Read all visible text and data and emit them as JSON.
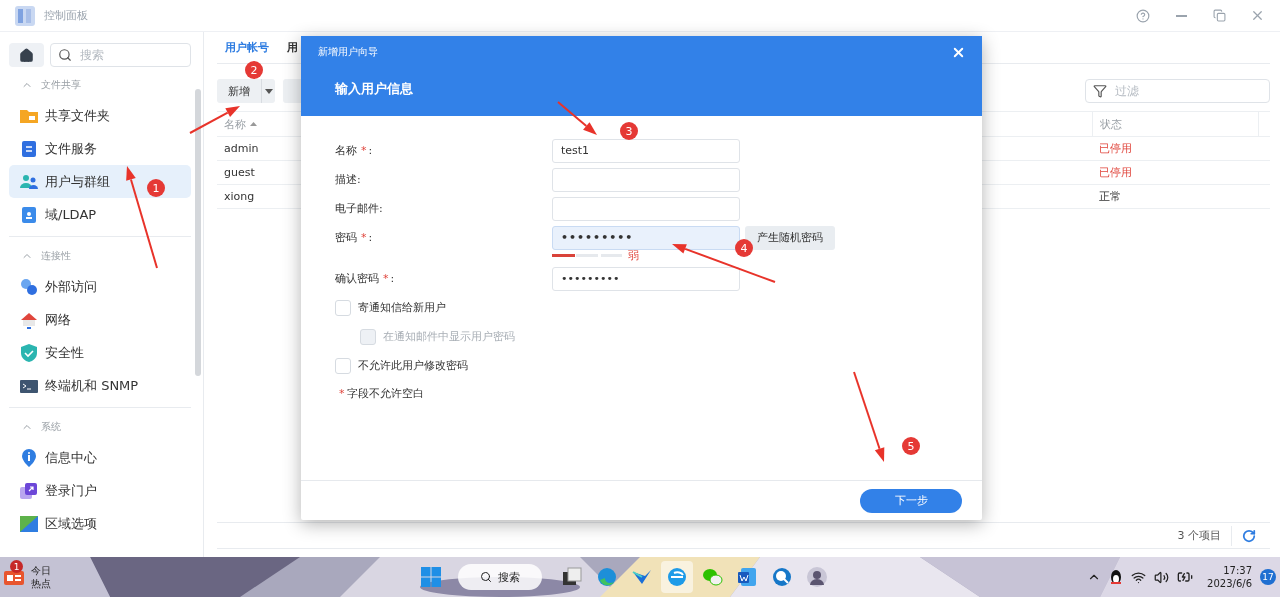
{
  "window": {
    "title": "控制面板"
  },
  "sidebar": {
    "search": {
      "placeholder": "搜索"
    },
    "sections": [
      {
        "title": "文件共享",
        "expanded": true,
        "items": [
          {
            "kind": "folder",
            "label": "共享文件夹",
            "selected": false
          },
          {
            "kind": "file-service",
            "label": "文件服务",
            "selected": false
          },
          {
            "kind": "users",
            "label": "用户与群组",
            "selected": true
          },
          {
            "kind": "ldap",
            "label": "域/LDAP",
            "selected": false
          }
        ]
      },
      {
        "title": "连接性",
        "expanded": true,
        "items": [
          {
            "kind": "external",
            "label": "外部访问",
            "selected": false
          },
          {
            "kind": "network",
            "label": "网络",
            "selected": false
          },
          {
            "kind": "security",
            "label": "安全性",
            "selected": false
          },
          {
            "kind": "terminal",
            "label": "终端机和 SNMP",
            "selected": false
          }
        ]
      },
      {
        "title": "系统",
        "expanded": true,
        "items": [
          {
            "kind": "info",
            "label": "信息中心",
            "selected": false
          },
          {
            "kind": "portal",
            "label": "登录门户",
            "selected": false
          },
          {
            "kind": "region",
            "label": "区域选项",
            "selected": false
          }
        ]
      }
    ]
  },
  "tabs": [
    {
      "label": "用户帐号",
      "selected": true
    },
    {
      "label": "用",
      "selected": false
    }
  ],
  "toolbar": {
    "create_button": "新增",
    "filter": {
      "placeholder": "过滤"
    }
  },
  "table": {
    "columns": [
      "名称",
      "状态"
    ],
    "rows": [
      {
        "name": "admin",
        "status": "已停用",
        "warning": true
      },
      {
        "name": "guest",
        "status": "已停用",
        "warning": true
      },
      {
        "name": "xiong",
        "status": "正常",
        "warning": false
      }
    ]
  },
  "footer": {
    "count": "3 个项目"
  },
  "dialog": {
    "title": "新增用户向导",
    "heading": "输入用户信息",
    "fields": [
      {
        "kind": "text",
        "label": "名称",
        "mark": "*",
        "colon": ":",
        "value": "test1",
        "focused": false
      },
      {
        "kind": "text",
        "label": "描述:",
        "focused": false
      },
      {
        "kind": "text",
        "label": "电子邮件:",
        "focused": false
      },
      {
        "kind": "password",
        "label": "密码",
        "mark": "*",
        "colon": ":",
        "value": "•••••••••",
        "focused": true,
        "button": "产生随机密码",
        "strength": {
          "level": 0.33,
          "label": "弱"
        }
      },
      {
        "kind": "text",
        "label": "确认密码",
        "mark": "*",
        "colon": ":",
        "value": "•••••••••",
        "focused": false
      }
    ],
    "checkboxes": [
      {
        "label": "寄通知信给新用户",
        "checked": false,
        "disabled": false,
        "children": [
          {
            "label": "在通知邮件中显示用户密码",
            "checked": false,
            "disabled": true
          }
        ]
      },
      {
        "label": "不允许此用户修改密码",
        "checked": false,
        "disabled": false
      }
    ],
    "note": {
      "mark": "*",
      "text": "字段不允许空白"
    },
    "next_button": "下一步"
  },
  "annotations": [
    {
      "number": "1"
    },
    {
      "number": "2"
    },
    {
      "number": "3"
    },
    {
      "number": "4"
    },
    {
      "number": "5"
    }
  ],
  "taskbar": {
    "news": {
      "badge": "1",
      "title": "今日",
      "subtitle": "热点"
    },
    "search": "搜索",
    "apps": [
      {
        "kind": "files",
        "selected": false
      },
      {
        "kind": "edge",
        "selected": false
      },
      {
        "kind": "feather",
        "selected": false
      },
      {
        "kind": "browser",
        "selected": true
      },
      {
        "kind": "chat",
        "selected": false
      },
      {
        "kind": "word",
        "selected": false
      },
      {
        "kind": "finder",
        "selected": false
      },
      {
        "kind": "avatar",
        "selected": false
      }
    ],
    "time": "17:37",
    "date": "2023/6/6",
    "notifications": "17"
  }
}
